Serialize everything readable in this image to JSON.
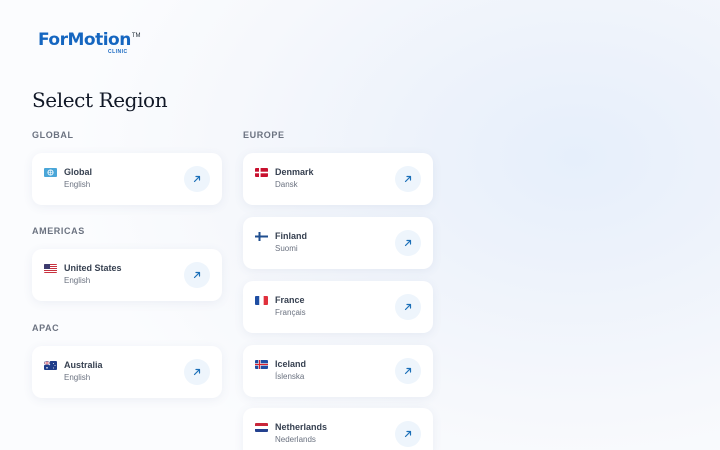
{
  "brand": {
    "name": "ForMotion",
    "tm": "TM",
    "sub": "CLINIC"
  },
  "page_title": "Select Region",
  "sections": {
    "global": {
      "label": "GLOBAL",
      "items": [
        {
          "country": "Global",
          "language": "English",
          "flag": "globe-flag-icon"
        }
      ]
    },
    "americas": {
      "label": "AMERICAS",
      "items": [
        {
          "country": "United States",
          "language": "English",
          "flag": "us-flag-icon"
        }
      ]
    },
    "apac": {
      "label": "APAC",
      "items": [
        {
          "country": "Australia",
          "language": "English",
          "flag": "au-flag-icon"
        }
      ]
    },
    "europe": {
      "label": "EUROPE",
      "items": [
        {
          "country": "Denmark",
          "language": "Dansk",
          "flag": "dk-flag-icon"
        },
        {
          "country": "Finland",
          "language": "Suomi",
          "flag": "fi-flag-icon"
        },
        {
          "country": "France",
          "language": "Français",
          "flag": "fr-flag-icon"
        },
        {
          "country": "Iceland",
          "language": "Íslenska",
          "flag": "is-flag-icon"
        },
        {
          "country": "Netherlands",
          "language": "Nederlands",
          "flag": "nl-flag-icon"
        }
      ]
    }
  },
  "colors": {
    "brand": "#1566c0",
    "arrow": "#1b6fb8",
    "button_bg": "#eef5fc"
  },
  "icons": {
    "go": "arrow-up-right-icon"
  }
}
